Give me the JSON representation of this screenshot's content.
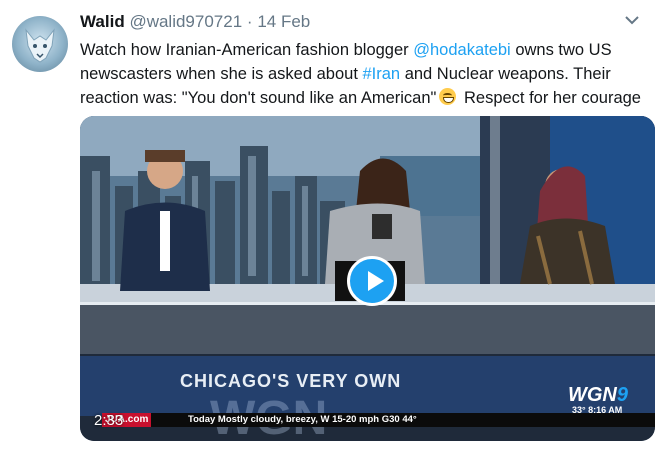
{
  "tweet": {
    "author_name": "Walid",
    "author_handle": "@walid970721",
    "separator": "·",
    "date": "14 Feb",
    "text_line1_a": "Watch how Iranian-American fashion blogger ",
    "mention": "@hodakatebi",
    "text_line1_b": " owns two US",
    "text_line2_a": "newscasters when she is asked about ",
    "hashtag": "#Iran",
    "text_line2_b": " and Nuclear weapons. Their",
    "text_line3_a": "reaction was: \"You don't sound like an American\"",
    "text_line3_b": " Respect for her courage",
    "emoji": "grinning-face-emoji"
  },
  "video": {
    "duration": "2:33",
    "overlay_title": "CHICAGO'S VERY OWN",
    "watermark": "WGN",
    "logo_text": "WGN",
    "logo_number": "9",
    "logo_time": "33° 8:16 AM",
    "ticker_brand": "JUA.com",
    "ticker_text": "Today  Mostly cloudy, breezy, W 15-20 mph G30  44°"
  },
  "colors": {
    "link": "#1da1f2",
    "play_button": "#1da1f2",
    "secondary_text": "#657786"
  }
}
